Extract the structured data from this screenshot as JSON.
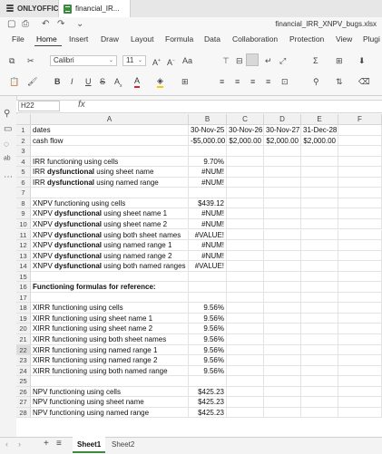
{
  "app": {
    "name": "ONLYOFFICE",
    "tab_title": "financial_IR...",
    "filename": "financial_IRR_XNPV_bugs.xlsx"
  },
  "menu": [
    "File",
    "Home",
    "Insert",
    "Draw",
    "Layout",
    "Formula",
    "Data",
    "Collaboration",
    "Protection",
    "View",
    "Plugi"
  ],
  "toolbar": {
    "font": "Calibri",
    "size": "11",
    "aa_big": "A",
    "aa_small": "A",
    "aa_case": "Aa"
  },
  "formula_bar": {
    "name_box": "H22",
    "fx": "fx",
    "formula": ""
  },
  "columns": [
    "A",
    "B",
    "C",
    "D",
    "E",
    "F"
  ],
  "rows": [
    {
      "n": "1",
      "a": "dates",
      "b": "30-Nov-25",
      "c": "30-Nov-26",
      "d": "30-Nov-27",
      "e": "31-Dec-28"
    },
    {
      "n": "2",
      "a": "cash flow",
      "b": "-$5,000.00",
      "c": "$2,000.00",
      "d": "$2,000.00",
      "e": "$2,000.00"
    },
    {
      "n": "3",
      "a": "",
      "b": ""
    },
    {
      "n": "4",
      "a": "IRR functioning using cells",
      "b": "9.70%"
    },
    {
      "n": "5",
      "a_pre": "IRR ",
      "a_bold": "dysfunctional",
      "a_post": " using sheet name",
      "b": "#NUM!"
    },
    {
      "n": "6",
      "a_pre": "IRR ",
      "a_bold": "dysfunctional",
      "a_post": " using named range",
      "b": "#NUM!"
    },
    {
      "n": "7",
      "a": "",
      "b": ""
    },
    {
      "n": "8",
      "a": "XNPV functioning using cells",
      "b": "$439.12"
    },
    {
      "n": "9",
      "a_pre": "XNPV ",
      "a_bold": "dysfunctional",
      "a_post": " using sheet name 1",
      "b": "#NUM!"
    },
    {
      "n": "10",
      "a_pre": "XNPV ",
      "a_bold": "dysfunctional",
      "a_post": " using sheet name 2",
      "b": "#NUM!"
    },
    {
      "n": "11",
      "a_pre": "XNPV ",
      "a_bold": "dysfunctional",
      "a_post": " using both sheet names",
      "b": "#VALUE!"
    },
    {
      "n": "12",
      "a_pre": "XNPV ",
      "a_bold": "dysfunctional",
      "a_post": " using named range 1",
      "b": "#NUM!"
    },
    {
      "n": "13",
      "a_pre": "XNPV ",
      "a_bold": "dysfunctional",
      "a_post": " using named range 2",
      "b": "#NUM!"
    },
    {
      "n": "14",
      "a_pre": "XNPV ",
      "a_bold": "dysfunctional",
      "a_post": " using both named ranges",
      "b": "#VALUE!"
    },
    {
      "n": "15",
      "a": "",
      "b": ""
    },
    {
      "n": "16",
      "a_allbold": "Functioning formulas for reference:",
      "b": ""
    },
    {
      "n": "17",
      "a": "",
      "b": ""
    },
    {
      "n": "18",
      "a": "XIRR functioning using cells",
      "b": "9.56%"
    },
    {
      "n": "19",
      "a": "XIRR functioning using sheet name 1",
      "b": "9.56%"
    },
    {
      "n": "20",
      "a": "XIRR functioning using sheet name 2",
      "b": "9.56%"
    },
    {
      "n": "21",
      "a": "XIRR functioning using both sheet names",
      "b": "9.56%"
    },
    {
      "n": "22",
      "a": "XIRR functioning using named range 1",
      "b": "9.56%"
    },
    {
      "n": "23",
      "a": "XIRR functioning using named range 2",
      "b": "9.56%"
    },
    {
      "n": "24",
      "a": "XIRR functioning using both named range",
      "b": "9.56%"
    },
    {
      "n": "25",
      "a": "",
      "b": ""
    },
    {
      "n": "26",
      "a": "NPV functioning using cells",
      "b": "$425.23"
    },
    {
      "n": "27",
      "a": "NPV functioning using sheet name",
      "b": "$425.23"
    },
    {
      "n": "28",
      "a": "NPV functioning using named range",
      "b": "$425.23"
    }
  ],
  "sheets": [
    "Sheet1",
    "Sheet2"
  ],
  "active_sheet": "Sheet1",
  "selected_row": "22"
}
